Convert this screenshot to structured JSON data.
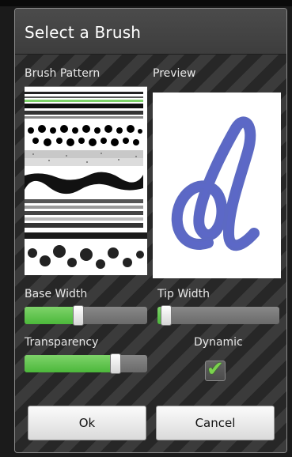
{
  "dialog": {
    "title": "Select a Brush",
    "brush_pattern_label": "Brush Pattern",
    "preview_label": "Preview",
    "base_width_label": "Base Width",
    "tip_width_label": "Tip Width",
    "transparency_label": "Transparency",
    "dynamic_label": "Dynamic",
    "ok_label": "Ok",
    "cancel_label": "Cancel"
  },
  "controls": {
    "base_width_fraction": 0.44,
    "tip_width_fraction": 0.07,
    "transparency_fraction": 0.74,
    "dynamic_checked": true
  },
  "colors": {
    "slider_fill": "#4cb83b",
    "check": "#7ad34d",
    "stroke": "#3f4fb8"
  },
  "icons": {
    "dynamic_check": "check-icon"
  }
}
